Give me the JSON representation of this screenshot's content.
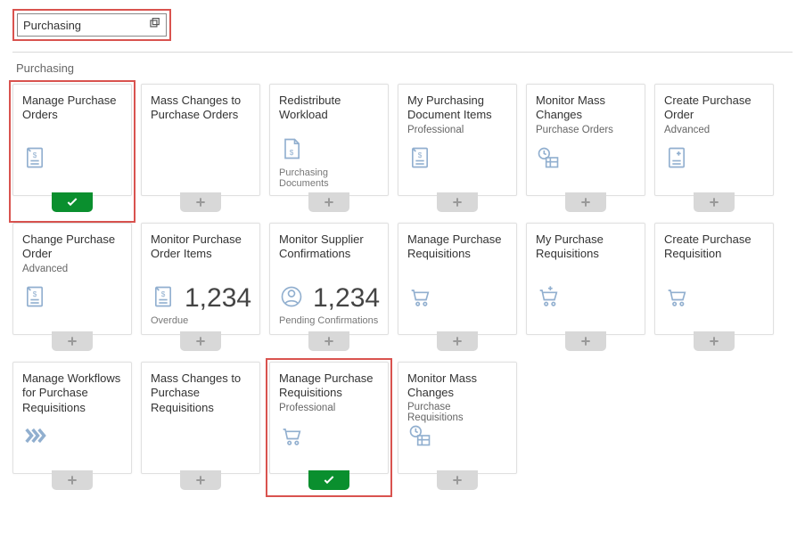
{
  "search": {
    "value": "Purchasing"
  },
  "group": {
    "title": "Purchasing"
  },
  "tiles": [
    {
      "title": "Manage Purchase Orders",
      "sub": "",
      "footer": "",
      "icon": "doc-dollar",
      "selected": true,
      "highlight": true
    },
    {
      "title": "Mass Changes to Purchase Orders",
      "sub": "",
      "footer": "",
      "icon": "",
      "selected": false
    },
    {
      "title": "Redistribute Workload",
      "sub": "",
      "footer": "Purchasing Documents",
      "icon": "doc-dollar-plain",
      "selected": false
    },
    {
      "title": "My Purchasing Document Items",
      "sub": "Professional",
      "footer": "",
      "icon": "doc-dollar",
      "selected": false
    },
    {
      "title": "Monitor Mass Changes",
      "sub": "Purchase Orders",
      "footer": "",
      "icon": "clock-table",
      "selected": false
    },
    {
      "title": "Create Purchase Order",
      "sub": "Advanced",
      "footer": "",
      "icon": "doc-plus",
      "selected": false
    },
    {
      "title": "Change Purchase Order",
      "sub": "Advanced",
      "footer": "",
      "icon": "doc-dollar",
      "selected": false
    },
    {
      "title": "Monitor Purchase Order Items",
      "sub": "",
      "footer": "Overdue",
      "icon": "doc-dollar",
      "kpi": "1,234",
      "selected": false
    },
    {
      "title": "Monitor Supplier Confirmations",
      "sub": "",
      "footer": "Pending Confirmations",
      "icon": "person",
      "kpi": "1,234",
      "selected": false
    },
    {
      "title": "Manage Purchase Requisitions",
      "sub": "",
      "footer": "",
      "icon": "cart",
      "selected": false
    },
    {
      "title": "My Purchase Requisitions",
      "sub": "",
      "footer": "",
      "icon": "cart-plus",
      "selected": false
    },
    {
      "title": "Create Purchase Requisition",
      "sub": "",
      "footer": "",
      "icon": "cart",
      "selected": false
    },
    {
      "title": "Manage Workflows for Purchase Requisitions",
      "sub": "",
      "footer": "",
      "icon": "chevrons",
      "selected": false
    },
    {
      "title": "Mass Changes to Purchase Requisitions",
      "sub": "",
      "footer": "",
      "icon": "",
      "selected": false
    },
    {
      "title": "Manage Purchase Requisitions",
      "sub": "Professional",
      "footer": "",
      "icon": "cart",
      "selected": true,
      "highlight": true
    },
    {
      "title": "Monitor Mass Changes",
      "sub": "Purchase Requisitions",
      "footer": "",
      "icon": "clock-table",
      "selected": false
    }
  ]
}
